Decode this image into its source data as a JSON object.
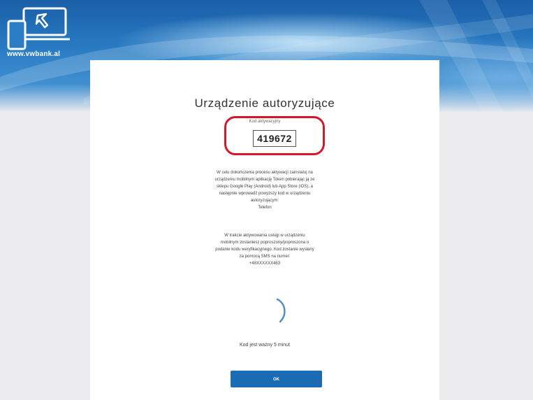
{
  "header": {
    "logo_text": "www.vwbank.al"
  },
  "card": {
    "title": "Urządzenie autoryzujące",
    "code_label": "Kod aktywacyjny",
    "code_value": "419672",
    "paragraph1": [
      "W celu dokończenia procesu aktywacji zainstaluj na",
      "urządzeniu mobilnym aplikację Token pobierając ją ze",
      "sklepu Google Play (Android) lub App Store (iOS), a",
      "następnie wprowadź powyższy kod w urządzeniu",
      "autoryzującym:",
      "Telefon"
    ],
    "paragraph2": [
      "W trakcie aktywowania usługi w urządzeniu",
      "mobilnym zostaniesz poproszony/poproszona o",
      "podanie kodu weryfikacyjnego. Kod zostanie wysłany",
      "za pomocą SMS na numer:",
      "+48XXXXXX463"
    ],
    "wait_text": "Kod jest ważny 5 minut",
    "ok_label": "OK"
  }
}
